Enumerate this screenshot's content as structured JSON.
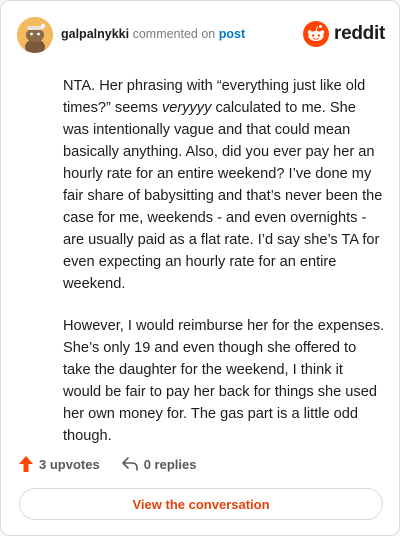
{
  "header": {
    "username": "galpalnykki",
    "action_text": "commented on",
    "post_link": "post",
    "brand": "reddit"
  },
  "comment": {
    "p1_a": "NTA. Her phrasing with “everything just like old times?” seems ",
    "p1_em": "veryyyy",
    "p1_b": " calculated to me. She was intentionally vague and that could mean basically anything. Also, did you ever pay her an hourly rate for an entire weekend? I’ve done my fair share of babysitting and that’s never been the case for me, weekends - and even overnights - are usually paid as a flat rate. I’d say she’s TA for even expecting an hourly rate for an entire weekend.",
    "p2": "However, I would reimburse her for the expenses. She’s only 19 and even though she offered to take the daughter for the weekend, I think it would be fair to pay her back for things she used her own money for. The gas part is a little odd though."
  },
  "footer": {
    "upvotes": "3 upvotes",
    "replies": "0 replies",
    "view_button": "View the conversation"
  },
  "colors": {
    "brand_orange": "#ff4500",
    "link_blue": "#0079d3",
    "button_text": "#e0440e"
  },
  "icons": [
    "avatar-snoo",
    "reddit-logo-icon",
    "upvote-arrow-icon",
    "reply-arrow-icon"
  ]
}
